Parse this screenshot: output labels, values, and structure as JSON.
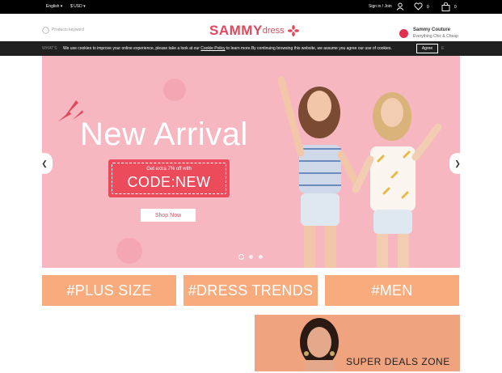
{
  "topbar": {
    "language": "English",
    "currency": "$ USD",
    "signin_label": "Sign in / Join",
    "wishlist_count": "0",
    "bag_count": "0"
  },
  "header": {
    "search_placeholder": "Products keyword",
    "logo_brand": "SAMMY",
    "logo_suffix": "dress",
    "couture_name": "Sammy Couture",
    "couture_tagline": "Everything Chic & Cheap"
  },
  "cookie": {
    "ghost_left": "WHAT'S",
    "message_pre": "We use cookies to improve your online experience, please take a look at our ",
    "policy_link": "Cookie Policy",
    "message_post": " to learn more.By continuing browsing this website, we assume you agree our use of cookies.",
    "ghost_right": "E",
    "agree_label": "Agree"
  },
  "hero": {
    "title": "New Arrival",
    "offer_text": "Get extra 7% off with",
    "code_text": "CODE:NEW",
    "shop_button": "Shop Now",
    "prev_arrow": "❮",
    "next_arrow": "❯",
    "slide_count": 3,
    "active_slide": 1
  },
  "categories": [
    {
      "label": "#PLUS SIZE"
    },
    {
      "label": "#DRESS TRENDS"
    },
    {
      "label": "#MEN"
    }
  ],
  "deals": {
    "label": "SUPER DEALS ZONE"
  },
  "colors": {
    "brand": "#e1485d",
    "hero_bg": "#f6b7c0",
    "tile_bg": "#f8ab7c",
    "code_bg": "#ec4b5c"
  }
}
